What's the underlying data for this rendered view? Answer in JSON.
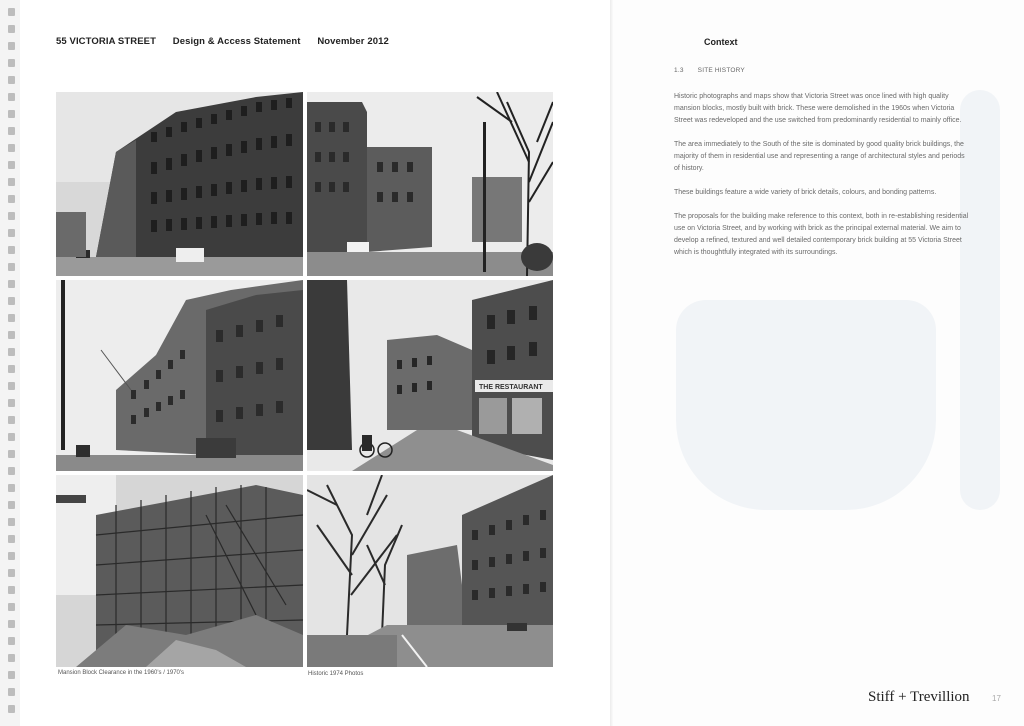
{
  "header": {
    "project": "55 VICTORIA STREET",
    "doc": "Design & Access Statement",
    "date": "November 2012"
  },
  "photos": [
    {
      "name": "photo-mansion-block-street"
    },
    {
      "name": "photo-trees-street-corner"
    },
    {
      "name": "photo-ornate-mansion-block"
    },
    {
      "name": "photo-restaurant-corner"
    },
    {
      "name": "photo-demolition"
    },
    {
      "name": "photo-historic-1974-street"
    }
  ],
  "captions": {
    "left": "Mansion Block Clearance in the 1960's / 1970's",
    "right": "Historic 1974 Photos"
  },
  "photo_signs": {
    "restaurant": "THE RESTAURANT"
  },
  "context": {
    "title": "Context",
    "section_number": "1.3",
    "section_title": "SITE HISTORY",
    "paragraphs": [
      "Historic photographs and maps show that Victoria Street was once lined with high quality mansion blocks, mostly built with brick. These were demolished in the 1960s when Victoria Street was redeveloped and the use switched from predominantly residential to mainly office.",
      "The area immediately to the South of the site is dominated by good quality brick buildings, the majority of them in residential use and representing a range of architectural styles and periods of history.",
      "These buildings feature a wide variety of brick details, colours, and bonding patterns.",
      "The proposals for the building make reference to this context, both in re-establishing residential use on Victoria Street, and by working with brick as the principal external material. We aim to develop a refined, textured and well detailed contemporary brick building at 55 Victoria Street which is thoughtfully integrated with its surroundings."
    ]
  },
  "footer": {
    "logo": "Stiff + Trevillion",
    "page_number": "17"
  }
}
